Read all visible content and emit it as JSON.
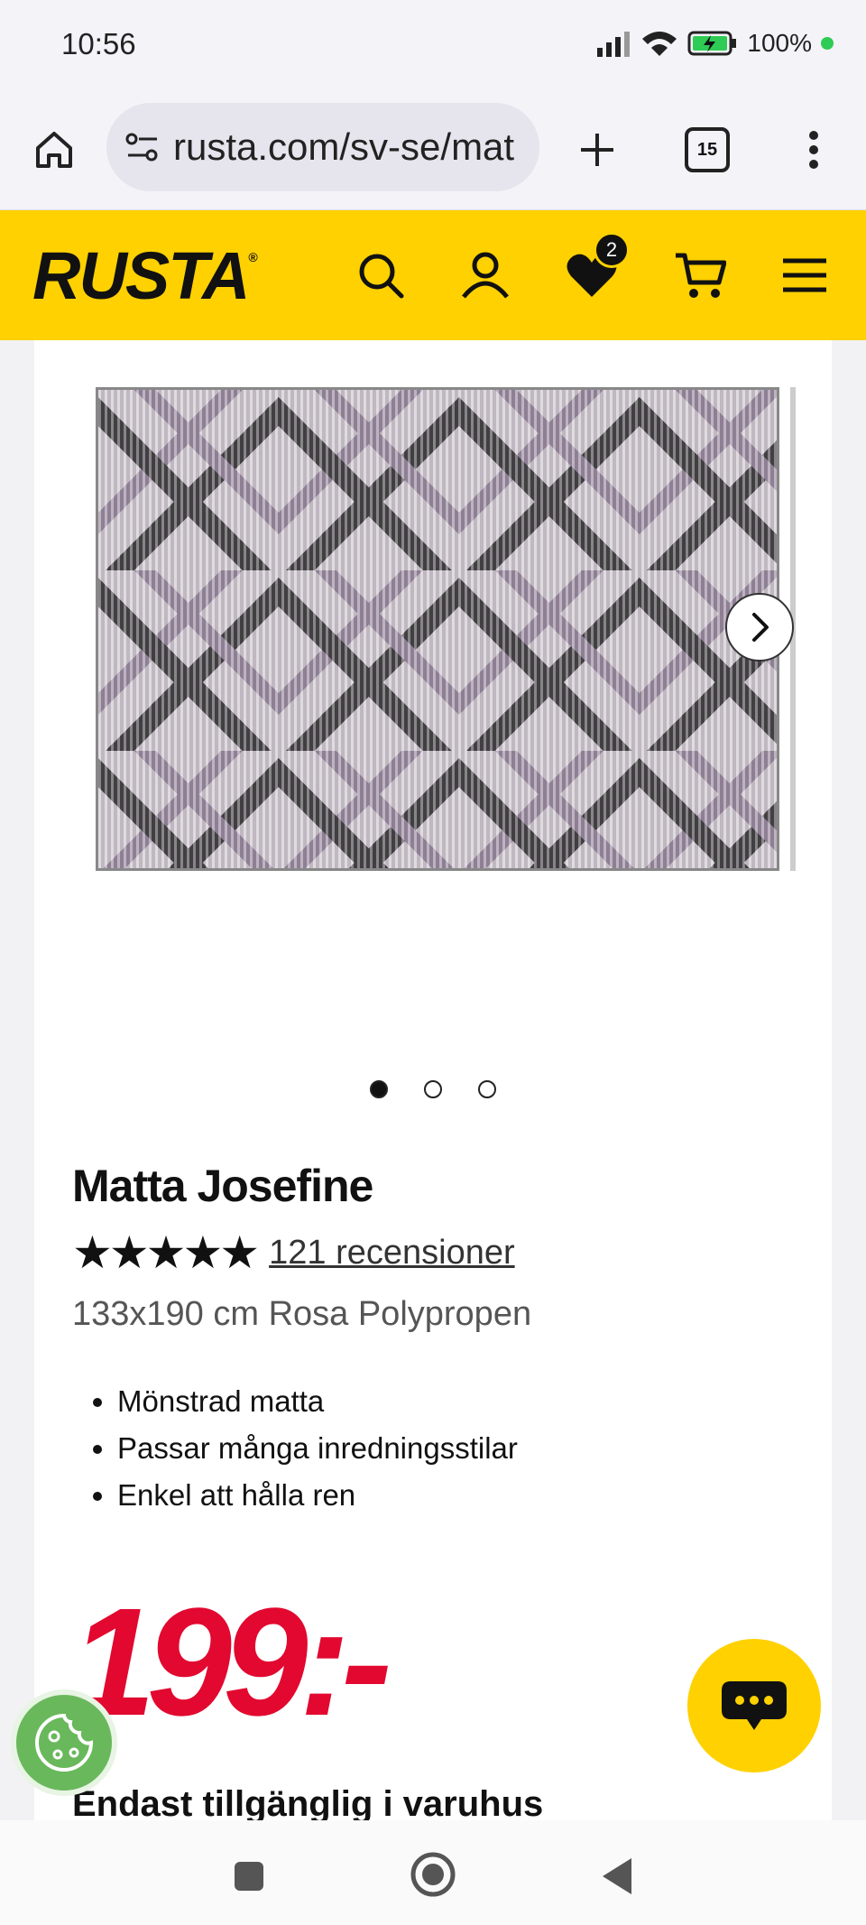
{
  "status_bar": {
    "time": "10:56",
    "battery": "100%"
  },
  "browser": {
    "url": "rusta.com/sv-se/mat",
    "tab_count": "15"
  },
  "header": {
    "logo": "RUSTA",
    "wishlist_count": "2"
  },
  "product": {
    "title": "Matta Josefine",
    "rating": 5,
    "reviews_link": "121 recensioner",
    "subtitle": "133x190 cm Rosa Polypropen",
    "features": [
      "Mönstrad matta",
      "Passar många inredningsstilar",
      "Enkel att hålla ren"
    ],
    "price": "199:-",
    "availability": "Endast tillgänglig i varuhus",
    "gallery": {
      "image_count": 3,
      "active_index": 0
    }
  },
  "colors": {
    "brand_yellow": "#ffd100",
    "price_red": "#e2082f",
    "cookie_green": "#69b85c"
  },
  "icons": [
    "home-icon",
    "site-settings-icon",
    "plus-icon",
    "tabs-icon",
    "more-vert-icon",
    "search-icon",
    "user-icon",
    "heart-icon",
    "cart-icon",
    "menu-icon",
    "chevron-right-icon",
    "chat-icon",
    "cookie-icon",
    "recents-icon",
    "home-nav-icon",
    "back-icon"
  ]
}
